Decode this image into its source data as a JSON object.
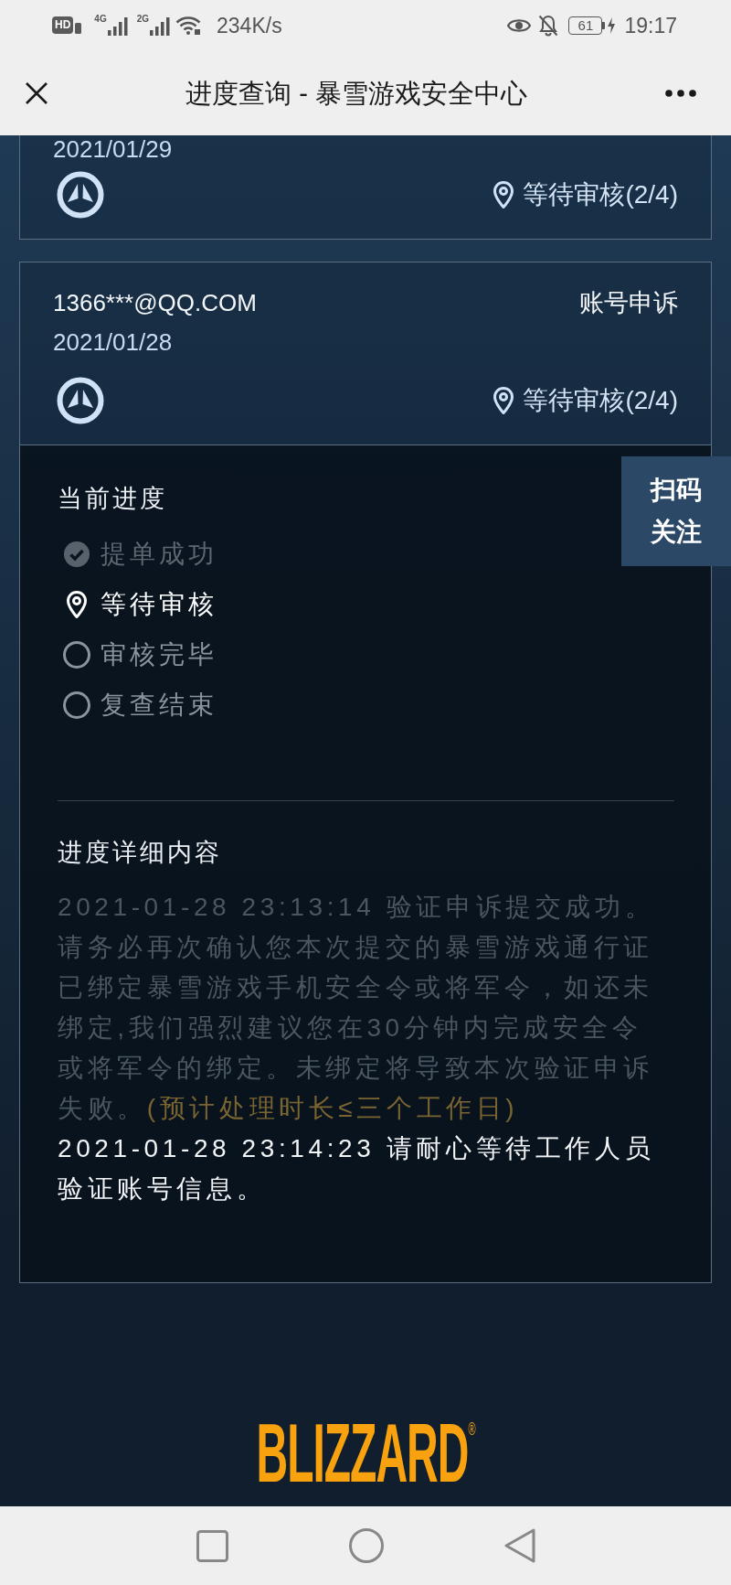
{
  "status_bar": {
    "hd_badge": "HD",
    "signals": [
      {
        "label": "4G"
      },
      {
        "label": "2G"
      }
    ],
    "speed": "234K/s",
    "battery": "61",
    "time": "19:17"
  },
  "title_bar": {
    "title": "进度查询 - 暴雪游戏安全中心"
  },
  "cards": [
    {
      "date": "2021/01/29",
      "status": "等待审核(2/4)",
      "expanded": false
    },
    {
      "account": "1366***@QQ.COM",
      "category": "账号申诉",
      "date": "2021/01/28",
      "status": "等待审核(2/4)",
      "expanded": true
    }
  ],
  "detail_panel": {
    "progress_title": "当前进度",
    "steps": [
      {
        "label": "提单成功",
        "kind": "done"
      },
      {
        "label": "等待审核",
        "kind": "current"
      },
      {
        "label": "审核完毕",
        "kind": "pending"
      },
      {
        "label": "复查结束",
        "kind": "pending"
      }
    ],
    "details_title": "进度详细内容",
    "entries": [
      {
        "text": "2021-01-28 23:13:14 验证申诉提交成功。请务必再次确认您本次提交的暴雪游戏通行证已绑定暴雪游戏手机安全令或将军令，如还未绑定,我们强烈建议您在30分钟内完成安全令或将军令的绑定。未绑定将导致本次验证申诉失败。",
        "note": "(预计处理时长≤三个工作日)",
        "active": false
      },
      {
        "text": "2021-01-28 23:14:23 请耐心等待工作人员验证账号信息。",
        "active": true
      }
    ]
  },
  "float_button": {
    "label": "扫码关注"
  },
  "footer": {
    "logo": "BLIZZARD$^{®}$"
  }
}
